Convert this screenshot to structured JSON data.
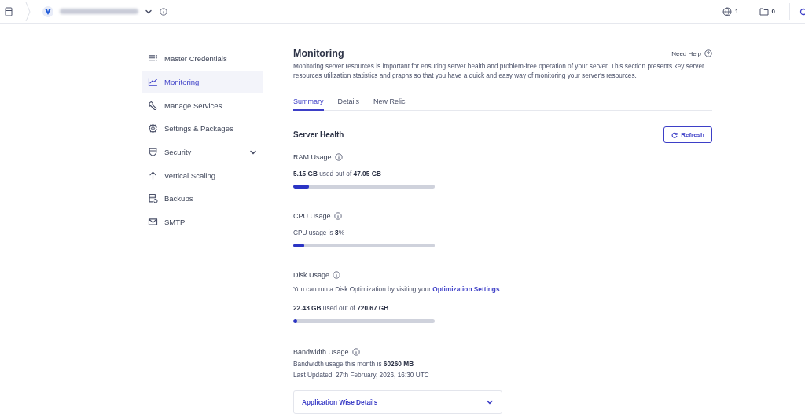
{
  "top_bar": {
    "servers_count": "1",
    "folders_count": "0"
  },
  "sidebar": {
    "items": [
      {
        "label": "Master Credentials",
        "selected": false,
        "expandable": false
      },
      {
        "label": "Monitoring",
        "selected": true,
        "expandable": false
      },
      {
        "label": "Manage Services",
        "selected": false,
        "expandable": false
      },
      {
        "label": "Settings & Packages",
        "selected": false,
        "expandable": false
      },
      {
        "label": "Security",
        "selected": false,
        "expandable": true
      },
      {
        "label": "Vertical Scaling",
        "selected": false,
        "expandable": false
      },
      {
        "label": "Backups",
        "selected": false,
        "expandable": false
      },
      {
        "label": "SMTP",
        "selected": false,
        "expandable": false
      }
    ]
  },
  "main": {
    "title": "Monitoring",
    "help_link": "Need Help",
    "description": "Monitoring server resources is important for ensuring server health and problem-free operation of your server. This section presents key server resources utilization statistics and graphs so that you have a quick and easy way of monitoring your server's resources.",
    "tabs": [
      {
        "label": "Summary",
        "selected": true
      },
      {
        "label": "Details",
        "selected": false
      },
      {
        "label": "New Relic",
        "selected": false
      }
    ],
    "section_title": "Server Health",
    "refresh_button": "Refresh",
    "usages": [
      {
        "kind": "meter",
        "title": "RAM Usage",
        "text": "**5.15 GB** used out of **47.05 GB**",
        "level": 0.11
      },
      {
        "kind": "meter",
        "title": "CPU Usage",
        "text": "CPU usage is **8**%",
        "level": 0.08
      },
      {
        "kind": "meter",
        "title": "Disk Usage",
        "note": "You can run a Disk Optimization by visiting your ",
        "note_link": "Optimization Settings",
        "text": "**22.43 GB** used out of **720.67 GB**",
        "level": 0.03
      },
      {
        "kind": "lines",
        "title": "Bandwidth Usage",
        "lines": [
          "Bandwidth usage this month is **60260 MB**",
          "Last Updated: 27th February, 2026, 16:30 UTC"
        ]
      }
    ],
    "accordion": {
      "label": "Application Wise Details",
      "expanded": false
    }
  }
}
